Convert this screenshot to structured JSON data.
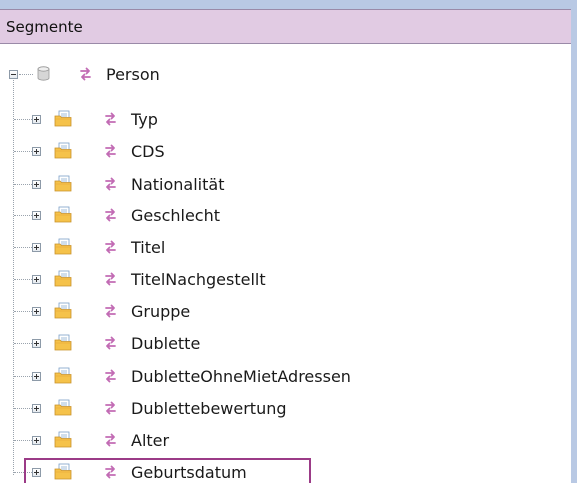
{
  "header": {
    "title": "Segmente"
  },
  "root": {
    "label": "Person",
    "icon": "database-icon"
  },
  "items": [
    {
      "label": "Typ"
    },
    {
      "label": "CDS"
    },
    {
      "label": "Nationalität"
    },
    {
      "label": "Geschlecht"
    },
    {
      "label": "Titel"
    },
    {
      "label": "TitelNachgestellt"
    },
    {
      "label": "Gruppe"
    },
    {
      "label": "Dublette"
    },
    {
      "label": "DubletteOhneMietAdressen"
    },
    {
      "label": "Dublettebewertung"
    },
    {
      "label": "Alter"
    },
    {
      "label": "Geburtsdatum",
      "highlighted": true
    }
  ],
  "colors": {
    "header_bg": "#e1cbe3",
    "top_strip": "#b9c9e4",
    "highlight_border": "#9b3b87",
    "segment_icon": "#c26bb4"
  }
}
